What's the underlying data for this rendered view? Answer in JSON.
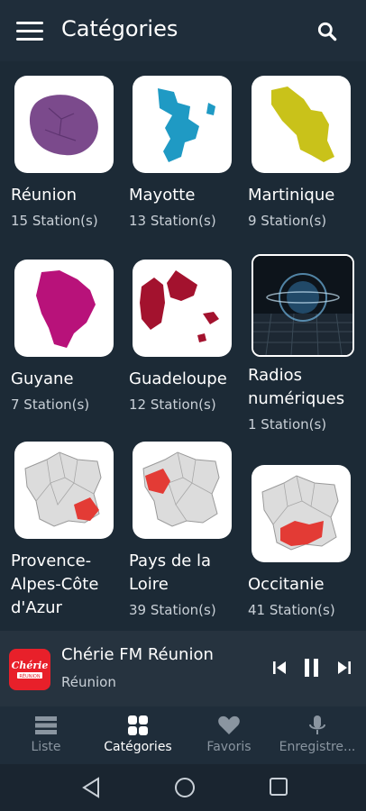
{
  "header": {
    "title": "Catégories"
  },
  "categories": [
    {
      "name": "Réunion",
      "count": "15 Station(s)",
      "icon": "reunion-map",
      "color": "#7b4a8c"
    },
    {
      "name": "Mayotte",
      "count": "13 Station(s)",
      "icon": "mayotte-map",
      "color": "#1f9ac4"
    },
    {
      "name": "Martinique",
      "count": "9 Station(s)",
      "icon": "martinique-map",
      "color": "#c9c21a"
    },
    {
      "name": "Guyane",
      "count": "7 Station(s)",
      "icon": "guyane-map",
      "color": "#b8127a"
    },
    {
      "name": "Guadeloupe",
      "count": "12 Station(s)",
      "icon": "guadeloupe-map",
      "color": "#a3122e"
    },
    {
      "name": "Radios numériques",
      "count": "1 Station(s)",
      "icon": "digital-radio-image",
      "color": "#1b2733"
    },
    {
      "name": "Provence-Alpes-Côte d'Azur",
      "count": "",
      "icon": "france-paca-map",
      "color": "#e33b35"
    },
    {
      "name": "Pays de la Loire",
      "count": "39 Station(s)",
      "icon": "france-loire-map",
      "color": "#e33b35"
    },
    {
      "name": "Occitanie",
      "count": "41 Station(s)",
      "icon": "france-occitanie-map",
      "color": "#e33b35"
    }
  ],
  "player": {
    "title": "Chérie FM Réunion",
    "subtitle": "Réunion",
    "logo_text": "Chérie",
    "logo_sub": "RÉUNION"
  },
  "nav": [
    {
      "label": "Liste",
      "icon": "list-icon"
    },
    {
      "label": "Catégories",
      "icon": "grid-icon",
      "active": true
    },
    {
      "label": "Favoris",
      "icon": "heart-icon"
    },
    {
      "label": "Enregistre...",
      "icon": "mic-icon"
    }
  ]
}
